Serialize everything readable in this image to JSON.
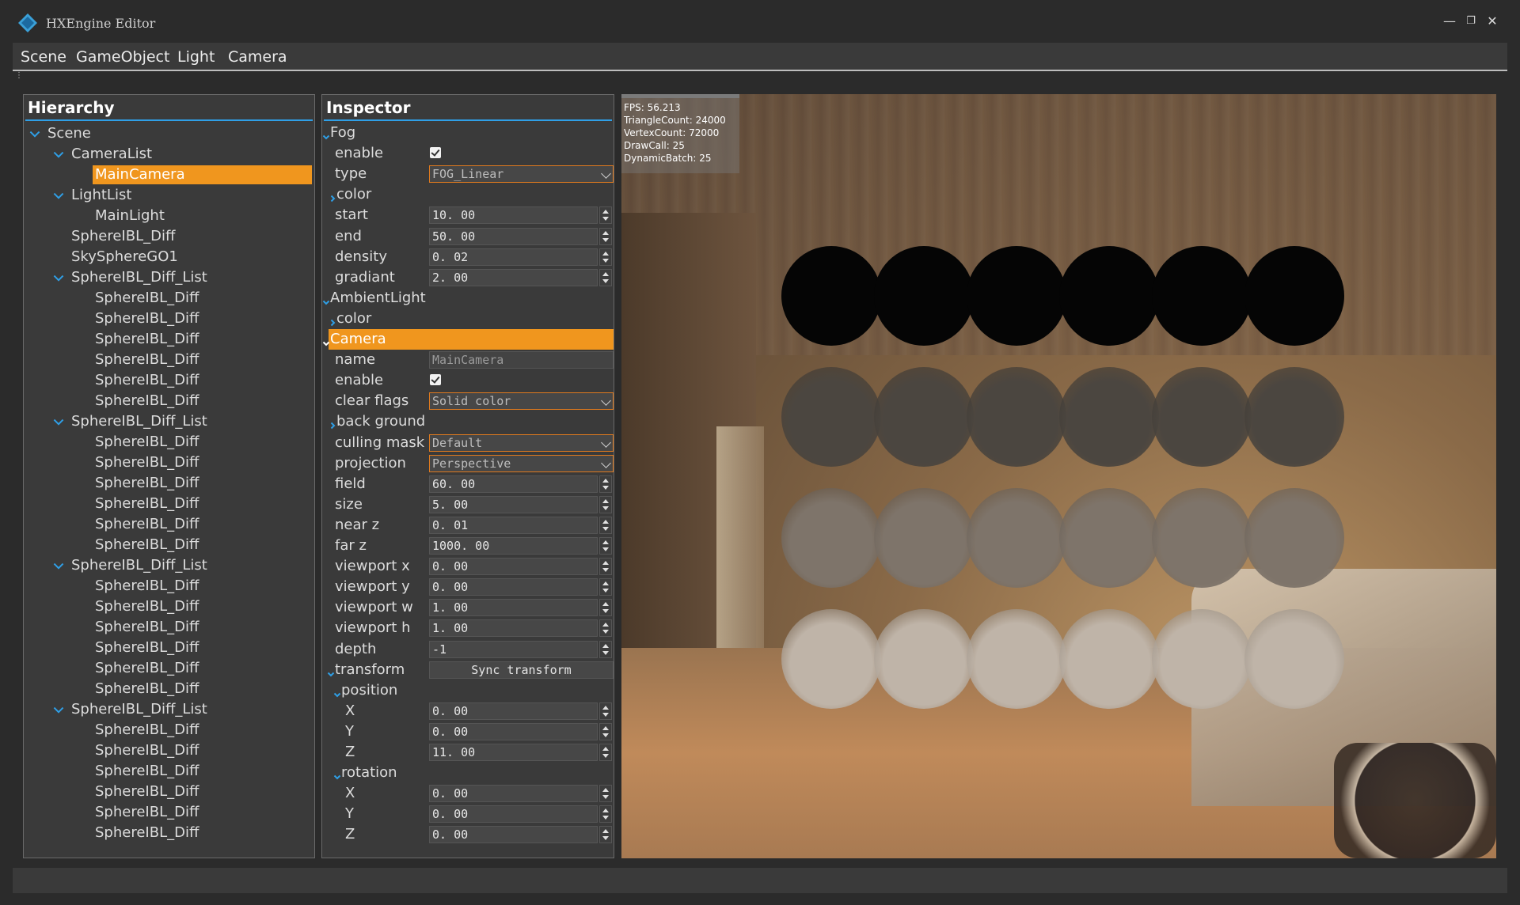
{
  "window": {
    "title": "HXEngine Editor",
    "logo_text": "HX",
    "controls": {
      "minimize": "—",
      "restore": "❐",
      "close": "✕"
    }
  },
  "menu": {
    "items": [
      "Scene",
      "GameObject",
      "Light",
      "Camera"
    ]
  },
  "hierarchy": {
    "title": "Hierarchy",
    "rows": [
      {
        "label": "Scene",
        "depth": 0,
        "expanded": true
      },
      {
        "label": "CameraList",
        "depth": 1,
        "expanded": true
      },
      {
        "label": "MainCamera",
        "depth": 2,
        "selected": true
      },
      {
        "label": "LightList",
        "depth": 1,
        "expanded": true
      },
      {
        "label": "MainLight",
        "depth": 2
      },
      {
        "label": "SphereIBL_Diff",
        "depth": 1
      },
      {
        "label": "SkySphereGO1",
        "depth": 1
      },
      {
        "label": "SphereIBL_Diff_List",
        "depth": 1,
        "expanded": true
      },
      {
        "label": "SphereIBL_Diff",
        "depth": 2
      },
      {
        "label": "SphereIBL_Diff",
        "depth": 2
      },
      {
        "label": "SphereIBL_Diff",
        "depth": 2
      },
      {
        "label": "SphereIBL_Diff",
        "depth": 2
      },
      {
        "label": "SphereIBL_Diff",
        "depth": 2
      },
      {
        "label": "SphereIBL_Diff",
        "depth": 2
      },
      {
        "label": "SphereIBL_Diff_List",
        "depth": 1,
        "expanded": true
      },
      {
        "label": "SphereIBL_Diff",
        "depth": 2
      },
      {
        "label": "SphereIBL_Diff",
        "depth": 2
      },
      {
        "label": "SphereIBL_Diff",
        "depth": 2
      },
      {
        "label": "SphereIBL_Diff",
        "depth": 2
      },
      {
        "label": "SphereIBL_Diff",
        "depth": 2
      },
      {
        "label": "SphereIBL_Diff",
        "depth": 2
      },
      {
        "label": "SphereIBL_Diff_List",
        "depth": 1,
        "expanded": true
      },
      {
        "label": "SphereIBL_Diff",
        "depth": 2
      },
      {
        "label": "SphereIBL_Diff",
        "depth": 2
      },
      {
        "label": "SphereIBL_Diff",
        "depth": 2
      },
      {
        "label": "SphereIBL_Diff",
        "depth": 2
      },
      {
        "label": "SphereIBL_Diff",
        "depth": 2
      },
      {
        "label": "SphereIBL_Diff",
        "depth": 2
      },
      {
        "label": "SphereIBL_Diff_List",
        "depth": 1,
        "expanded": true
      },
      {
        "label": "SphereIBL_Diff",
        "depth": 2
      },
      {
        "label": "SphereIBL_Diff",
        "depth": 2
      },
      {
        "label": "SphereIBL_Diff",
        "depth": 2
      },
      {
        "label": "SphereIBL_Diff",
        "depth": 2
      },
      {
        "label": "SphereIBL_Diff",
        "depth": 2
      },
      {
        "label": "SphereIBL_Diff",
        "depth": 2
      }
    ]
  },
  "inspector": {
    "title": "Inspector",
    "rows": [
      {
        "kind": "section",
        "label": "Fog",
        "expanded": true,
        "level": 0
      },
      {
        "kind": "check",
        "label": "enable",
        "checked": true
      },
      {
        "kind": "combo",
        "label": "type",
        "value": "FOG_Linear"
      },
      {
        "kind": "section",
        "label": "color",
        "expanded": false,
        "level": 1
      },
      {
        "kind": "spin",
        "label": "start",
        "value": "10. 00"
      },
      {
        "kind": "spin",
        "label": "end",
        "value": "50. 00"
      },
      {
        "kind": "spin",
        "label": "density",
        "value": "0. 02"
      },
      {
        "kind": "spin",
        "label": "gradiant",
        "value": "2. 00"
      },
      {
        "kind": "section",
        "label": "AmbientLight",
        "expanded": true,
        "level": 0
      },
      {
        "kind": "section",
        "label": "color",
        "expanded": false,
        "level": 1
      },
      {
        "kind": "header",
        "label": "Camera",
        "expanded": true
      },
      {
        "kind": "text",
        "label": "name",
        "value": "MainCamera"
      },
      {
        "kind": "check",
        "label": "enable",
        "checked": true
      },
      {
        "kind": "combo",
        "label": "clear flags",
        "value": "Solid color"
      },
      {
        "kind": "section",
        "label": "back ground",
        "expanded": false,
        "level": 1
      },
      {
        "kind": "combo",
        "label": "culling mask",
        "value": "Default"
      },
      {
        "kind": "combo",
        "label": "projection",
        "value": "Perspective"
      },
      {
        "kind": "spin",
        "label": "field",
        "value": "60. 00"
      },
      {
        "kind": "spin",
        "label": "size",
        "value": "5. 00"
      },
      {
        "kind": "spin",
        "label": "near z",
        "value": "0. 01"
      },
      {
        "kind": "spin",
        "label": "far z",
        "value": "1000. 00"
      },
      {
        "kind": "spin",
        "label": "viewport x",
        "value": "0. 00"
      },
      {
        "kind": "spin",
        "label": "viewport y",
        "value": "0. 00"
      },
      {
        "kind": "spin",
        "label": "viewport w",
        "value": "1. 00"
      },
      {
        "kind": "spin",
        "label": "viewport h",
        "value": "1. 00"
      },
      {
        "kind": "spin",
        "label": "depth",
        "value": "-1"
      },
      {
        "kind": "button",
        "label": "transform",
        "value": "Sync transform",
        "expanded": true
      },
      {
        "kind": "section",
        "label": "position",
        "expanded": true,
        "level": 2
      },
      {
        "kind": "spin",
        "label": "X",
        "value": "0. 00",
        "indent": true
      },
      {
        "kind": "spin",
        "label": "Y",
        "value": "0. 00",
        "indent": true
      },
      {
        "kind": "spin",
        "label": "Z",
        "value": "11. 00",
        "indent": true
      },
      {
        "kind": "section",
        "label": "rotation",
        "expanded": true,
        "level": 2
      },
      {
        "kind": "spin",
        "label": "X",
        "value": "0. 00",
        "indent": true
      },
      {
        "kind": "spin",
        "label": "Y",
        "value": "0. 00",
        "indent": true
      },
      {
        "kind": "spin",
        "label": "Z",
        "value": "0. 00",
        "indent": true
      }
    ]
  },
  "viewport": {
    "stats": [
      "FPS: 56.213",
      "TriangleCount: 24000",
      "VertexCount: 72000",
      "DrawCall: 25",
      "DynamicBatch: 25"
    ],
    "sphere_rows": [
      {
        "color": "#050505"
      },
      {
        "color": "#4b4640"
      },
      {
        "color": "#7e746a"
      },
      {
        "color": "#bfb4a8"
      }
    ],
    "sphere_columns": 6
  },
  "colors": {
    "accent": "#f0961e",
    "rule": "#2f9fe6",
    "panel": "#3a3a3a"
  }
}
